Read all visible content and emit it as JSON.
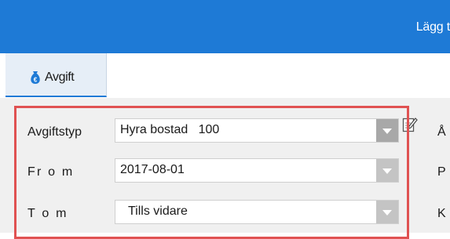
{
  "window": {
    "title": "Lägg t"
  },
  "tabs": [
    {
      "label": "Avgift",
      "icon": "money-bag-icon"
    }
  ],
  "form": {
    "fee_type": {
      "label": "Avgiftstyp",
      "value": "Hyra bostad   100"
    },
    "from": {
      "label": "Fr o m",
      "value": "2017-08-01"
    },
    "to": {
      "label": "T o m",
      "value": "Tills vidare"
    }
  },
  "side_labels": [
    "Å",
    "P",
    "K"
  ],
  "colors": {
    "accent": "#1e7ad6",
    "highlight": "#e05252"
  }
}
